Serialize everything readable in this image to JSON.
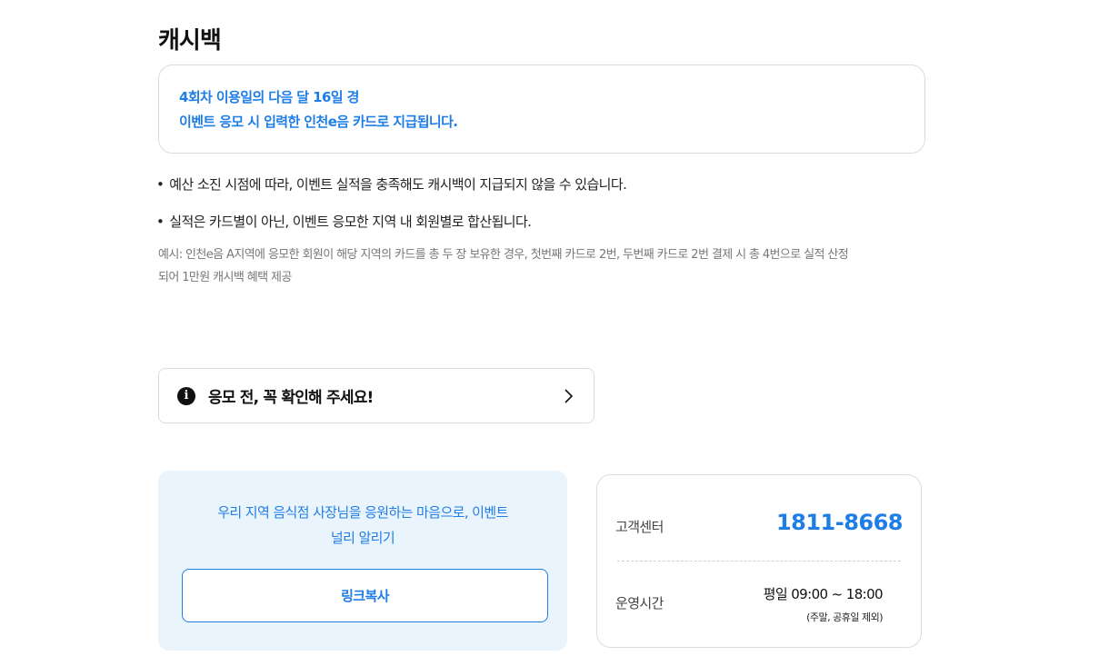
{
  "cashback": {
    "title": "캐시백",
    "info_lines": [
      "4회차 이용일의 다음 달 16일 경",
      "이벤트 응모 시 입력한 인천e음 카드로 지급됩니다."
    ],
    "notes": [
      "예산 소진 시점에 따라, 이벤트 실적을 충족해도 캐시백이 지급되지 않을 수 있습니다.",
      "실적은 카드별이 아닌, 이벤트 응모한 지역 내 회원별로 합산됩니다."
    ],
    "example_lines": [
      "예시: 인천e음 A지역에 응모한 회원이 해당 지역의 카드를 총 두 장 보유한 경우, 첫번째 카드로 2번, 두번째 카드로 2번 결제 시 총 4번으로 실적 산정",
      "되어 1만원 캐시백 혜택 제공"
    ]
  },
  "check": {
    "label": "응모 전, 꼭 확인해 주세요!",
    "icon": "info-icon"
  },
  "share": {
    "text_lines": [
      "우리 지역 음식점 사장님을 응원하는 마음으로, 이벤트",
      "널리 알리기"
    ],
    "button_label": "링크복사"
  },
  "support": {
    "center_label": "고객센터",
    "phone": "1811-8668",
    "hours_label": "운영시간",
    "hours": "평일 09:00 ~ 18:00",
    "hours_note": "(주말, 공휴일 제외)"
  },
  "colors": {
    "accent": "#1f7de6",
    "share_bg": "#eaf4fd",
    "border": "#dcdcdc"
  }
}
